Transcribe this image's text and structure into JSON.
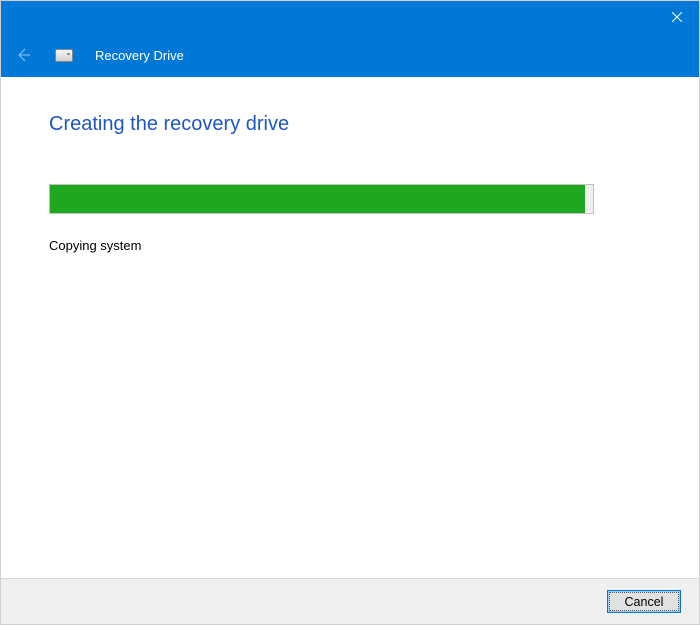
{
  "header": {
    "app_title": "Recovery Drive"
  },
  "main": {
    "heading": "Creating the recovery drive",
    "status": "Copying system",
    "progress_percent": 98.5
  },
  "footer": {
    "cancel_label": "Cancel"
  },
  "icons": {
    "close": "close-icon",
    "back": "back-arrow-icon",
    "drive": "drive-icon"
  }
}
